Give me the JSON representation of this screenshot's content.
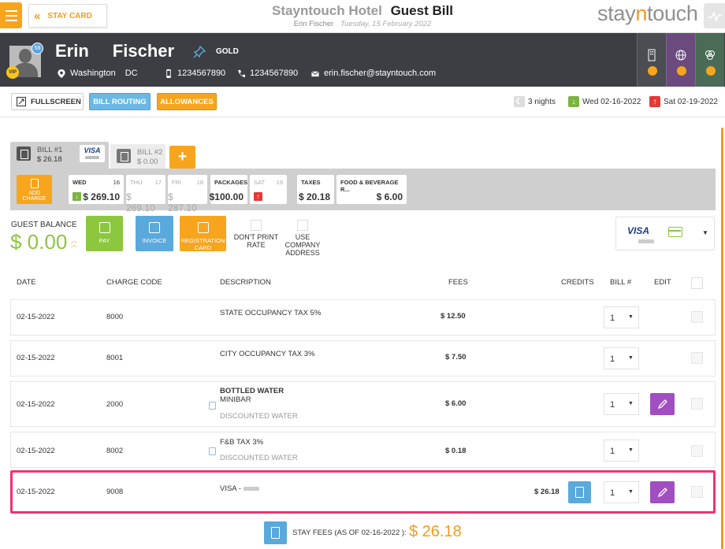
{
  "topbar": {
    "stay_card_label": "STAY CARD",
    "hotel_name": "Stayntouch Hotel",
    "page_title": "Guest Bill",
    "guest_name": "Erin Fischer",
    "date": "Tuesday, 15 February 2022",
    "logo_part1": "stay",
    "logo_part2": "n",
    "logo_part3": "touch"
  },
  "guest": {
    "first_name": "Erin",
    "last_name": "Fischer",
    "badge_count": "58",
    "vip_label": "VIP",
    "tier": "GOLD",
    "city": "Washington",
    "state": "DC",
    "phone1": "1234567890",
    "phone2": "1234567890",
    "email": "erin.fischer@stayntouch.com"
  },
  "toolbar": {
    "fullscreen_label": "FULLSCREEN",
    "bill_routing_label": "BILL ROUTING",
    "allowances_label": "ALLOWANCES",
    "nights": "3 nights",
    "arrival": "Wed 02-16-2022",
    "departure": "Sat 02-19-2022"
  },
  "bills": {
    "tabs": [
      {
        "label": "BILL #1",
        "amount": "$ 26.18",
        "card": "VISA"
      },
      {
        "label": "BILL #2",
        "amount": "$ 0.00"
      }
    ],
    "add_bill_label": "+",
    "add_charge_label": "ADD CHARGE",
    "days": [
      {
        "name": "WED",
        "day": "16",
        "value": "$ 269.10"
      },
      {
        "name": "THU",
        "day": "17",
        "value": "$ 269.10"
      },
      {
        "name": "FRI",
        "day": "18",
        "value": "$ 287.10"
      },
      {
        "name": "PACKAGES",
        "value": "$100.00"
      },
      {
        "name": "SAT",
        "day": "19"
      },
      {
        "name": "TAXES",
        "value": "$ 20.18"
      },
      {
        "name": "FOOD & BEVERAGE R...",
        "value": "$ 6.00"
      }
    ]
  },
  "balance": {
    "label": "GUEST BALANCE",
    "amount": "$ 0.00",
    "pay_label": "PAY",
    "invoice_label": "INVOICE",
    "registration_label": "REGISTRATION CARD",
    "dont_print_label": "DON'T PRINT RATE",
    "use_company_label": "USE COMPANY ADDRESS",
    "card_brand": "VISA"
  },
  "table": {
    "headers": {
      "date": "DATE",
      "charge_code": "CHARGE CODE",
      "description": "DESCRIPTION",
      "fees": "FEES",
      "credits": "CREDITS",
      "bill": "BILL #",
      "edit": "EDIT"
    },
    "rows": [
      {
        "date": "02-15-2022",
        "code": "8000",
        "desc": "STATE OCCUPANCY TAX 5%",
        "fees": "$ 12.50",
        "bill": "1"
      },
      {
        "date": "02-15-2022",
        "code": "8001",
        "desc": "CITY OCCUPANCY TAX 3%",
        "fees": "$ 7.50",
        "bill": "1"
      },
      {
        "date": "02-15-2022",
        "code": "2000",
        "desc": "BOTTLED WATER",
        "desc2": "MINIBAR",
        "desc3": "DISCOUNTED WATER",
        "fees": "$ 6.00",
        "bill": "1"
      },
      {
        "date": "02-15-2022",
        "code": "8002",
        "desc": "F&B TAX 3%",
        "desc3": "DISCOUNTED WATER",
        "fees": "$ 0.18",
        "bill": "1"
      },
      {
        "date": "02-15-2022",
        "code": "9008",
        "desc": "VISA -",
        "credits": "$ 26.18",
        "bill": "1"
      }
    ]
  },
  "footer": {
    "label": "STAY FEES (AS OF 02-16-2022 ):",
    "amount": "$ 26.18"
  },
  "colors": {
    "orange": "#f7a51d",
    "blue": "#5aa9dc",
    "green": "#8dc63f",
    "purple": "#a14ec2",
    "highlight": "#f0336e",
    "dark": "#3c3e43"
  }
}
